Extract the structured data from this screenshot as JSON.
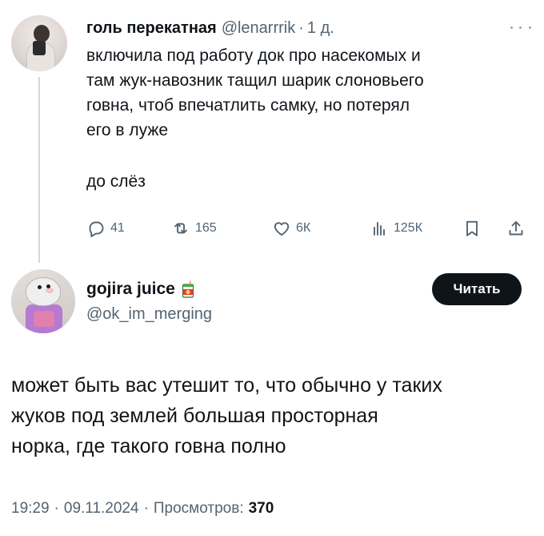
{
  "tweet1": {
    "author_name": "голь перекатная",
    "author_handle": "@lenarrrik",
    "separator": "·",
    "time": "1 д.",
    "text_lines": [
      "включила под работу док про насекомых и",
      "там жук-навозник тащил шарик слоновьего",
      "говна, чтоб впечатлить самку, но потерял",
      "его в луже"
    ],
    "text_tail": "до слёз",
    "replies": "41",
    "retweets": "165",
    "likes": "6К",
    "views": "125К"
  },
  "tweet2": {
    "author_name": "gojira juice",
    "author_handle": "@ok_im_merging",
    "follow_label": "Читать",
    "text_lines": [
      "может быть вас утешит то, что обычно у таких",
      "жуков под землей большая просторная",
      "норка, где такого говна полно"
    ],
    "time": "19:29",
    "date": "09.11.2024",
    "views_label": "Просмотров:",
    "views_count": "370",
    "separator": "·"
  },
  "icons": {
    "more": "more-horizontal-icon",
    "reply": "reply-icon",
    "retweet": "retweet-icon",
    "like": "heart-icon",
    "views": "views-bar-chart-icon",
    "bookmark": "bookmark-icon",
    "share": "share-icon",
    "juice": "juice-box-icon"
  },
  "colors": {
    "text": "#0f1419",
    "secondary": "#536471",
    "thread_line": "#cfd9de",
    "button_bg": "#0f1419",
    "button_text": "#ffffff"
  }
}
